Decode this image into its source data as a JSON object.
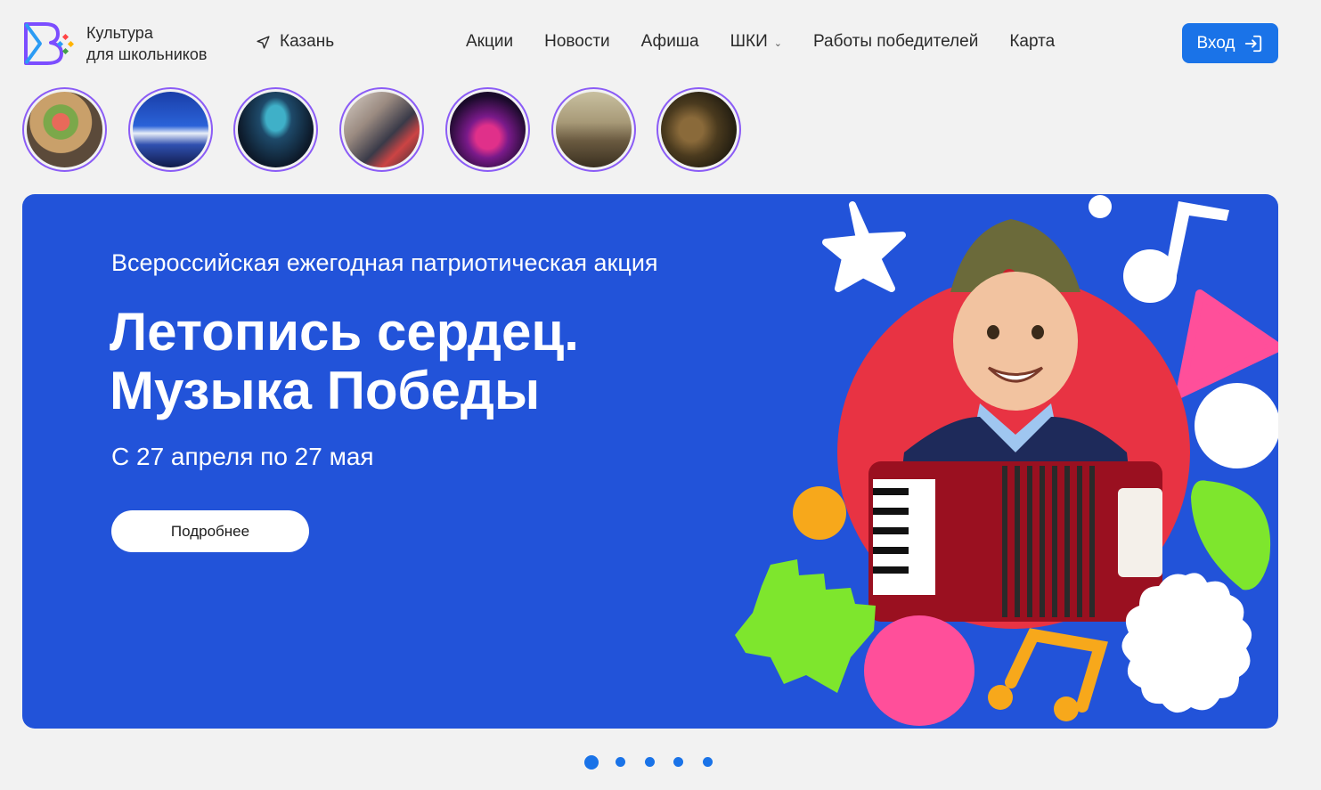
{
  "header": {
    "logo_line1": "Культура",
    "logo_line2": "для школьников",
    "city": "Казань",
    "nav": [
      {
        "label": "Акции"
      },
      {
        "label": "Новости"
      },
      {
        "label": "Афиша"
      },
      {
        "label": "ШКИ"
      },
      {
        "label": "Работы победителей"
      },
      {
        "label": "Карта"
      }
    ],
    "login_label": "Вход"
  },
  "stories": [
    {
      "name": "story-flowers-painting"
    },
    {
      "name": "story-stage-performance"
    },
    {
      "name": "story-concert-hall"
    },
    {
      "name": "story-people-talking"
    },
    {
      "name": "story-theater-show"
    },
    {
      "name": "story-painting-battle"
    },
    {
      "name": "story-film-scene"
    }
  ],
  "banner": {
    "subtitle": "Всероссийская ежегодная патриотическая акция",
    "title_line1": "Летопись сердец.",
    "title_line2": "Музыка Победы",
    "dates": "С 27 апреля по 27 мая",
    "button_label": "Подробнее"
  },
  "pagination": {
    "count": 5,
    "active": 1
  },
  "colors": {
    "accent": "#1a73e8",
    "banner_bg": "#2253d9",
    "story_ring": "#8b5cf6",
    "red_circle": "#e83343",
    "pink": "#ff4f9a",
    "green": "#7ee62d",
    "orange": "#f7a81b"
  }
}
